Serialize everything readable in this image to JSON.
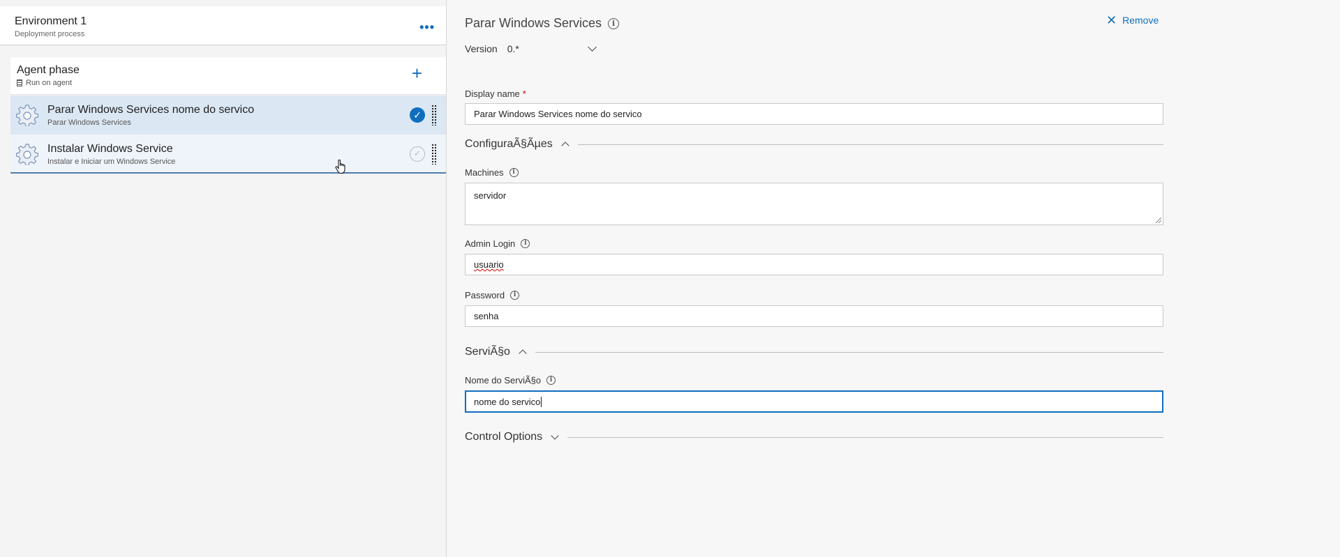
{
  "left": {
    "environment": {
      "title": "Environment 1",
      "subtitle": "Deployment process",
      "more": "•••"
    },
    "phase": {
      "title": "Agent phase",
      "subtitle": "Run on agent",
      "add": "+"
    },
    "tasks": [
      {
        "title": "Parar Windows Services nome do servico",
        "subtitle": "Parar Windows Services",
        "enabled": true,
        "check": "✓"
      },
      {
        "title": "Instalar Windows Service",
        "subtitle": "Instalar e Iniciar um Windows Service",
        "enabled": false,
        "check": "✓"
      }
    ]
  },
  "right": {
    "title": "Parar Windows Services",
    "remove": "Remove",
    "version": {
      "label": "Version",
      "value": "0.*"
    },
    "display_name": {
      "label": "Display name",
      "required": "*",
      "value": "Parar Windows Services nome do servico"
    },
    "sections": {
      "config": "ConfiguraÃ§Ãµes",
      "service": "ServiÃ§o",
      "control": "Control Options"
    },
    "fields": {
      "machines": {
        "label": "Machines",
        "value": "servidor"
      },
      "admin_login": {
        "label": "Admin Login",
        "value": "usuario"
      },
      "password": {
        "label": "Password",
        "value": "senha"
      },
      "service_name": {
        "label": "Nome do ServiÃ§o",
        "value": "nome do servico"
      }
    }
  },
  "colors": {
    "accent": "#106ebe",
    "selected_row": "#dbe7f3",
    "hover_row": "#eef4fa"
  }
}
